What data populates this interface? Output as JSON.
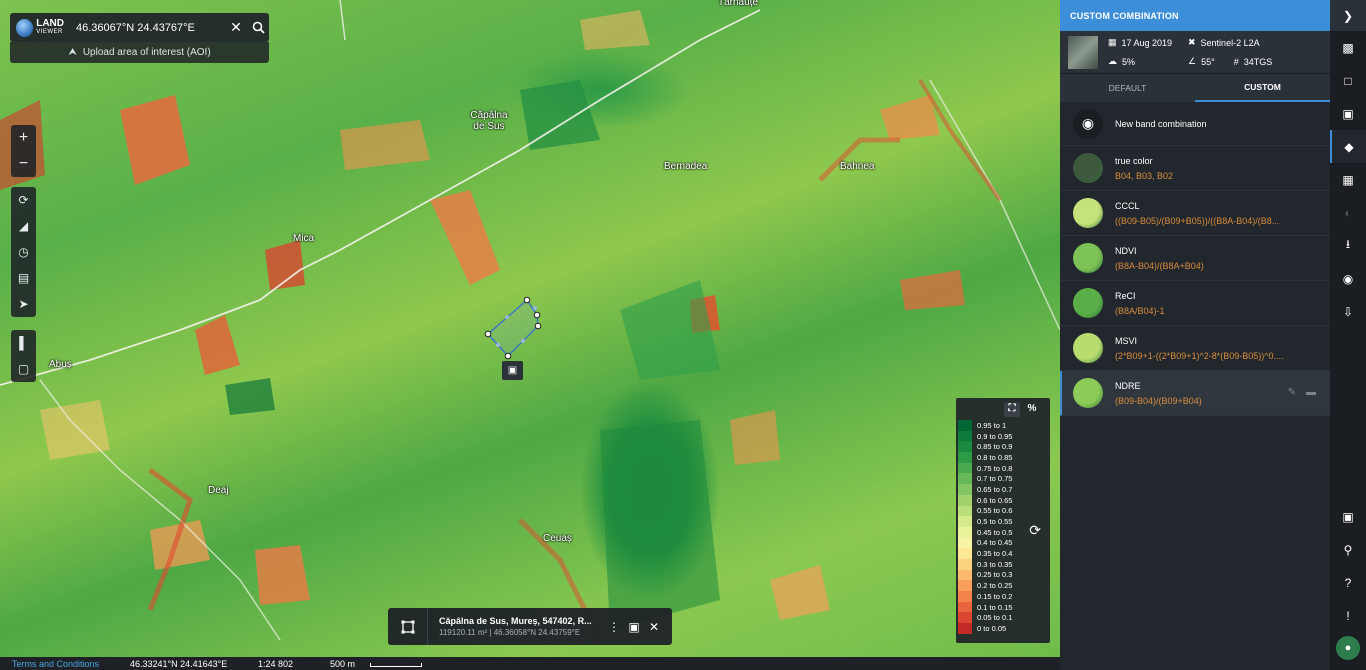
{
  "search": {
    "value": "46.36067°N 24.43767°E",
    "upload_label": "Upload area of interest (AOI)"
  },
  "logo": {
    "line1": "LAND",
    "line2": "VIEWER"
  },
  "places": [
    {
      "name": "Tărnăuțe"
    },
    {
      "name": "Căpâlna de Sus"
    },
    {
      "name": "Bernadea"
    },
    {
      "name": "Bahnea"
    },
    {
      "name": "Mica"
    },
    {
      "name": "Abuș"
    },
    {
      "name": "Deaj"
    },
    {
      "name": "Ceuaș"
    }
  ],
  "aoi": {
    "title": "Căpâlna de Sus, Mureș, 547402, R...",
    "info": "119120.11 m² | 46.36058°N 24.43759°E"
  },
  "legend": {
    "items": [
      {
        "label": "0.95 to 1",
        "color": "#006837"
      },
      {
        "label": "0.9 to 0.95",
        "color": "#0e7b3a"
      },
      {
        "label": "0.85 to 0.9",
        "color": "#1a8a3f"
      },
      {
        "label": "0.8 to 0.85",
        "color": "#2c9a46"
      },
      {
        "label": "0.75 to 0.8",
        "color": "#48a94e"
      },
      {
        "label": "0.7 to 0.75",
        "color": "#66b858"
      },
      {
        "label": "0.65 to 0.7",
        "color": "#84c563"
      },
      {
        "label": "0.6 to 0.65",
        "color": "#a1d26d"
      },
      {
        "label": "0.55 to 0.6",
        "color": "#bbdf7a"
      },
      {
        "label": "0.5 to 0.55",
        "color": "#d4ea8b"
      },
      {
        "label": "0.45 to 0.5",
        "color": "#e8f39c"
      },
      {
        "label": "0.4 to 0.45",
        "color": "#f7f4a6"
      },
      {
        "label": "0.35 to 0.4",
        "color": "#fde895"
      },
      {
        "label": "0.3 to 0.35",
        "color": "#fdd37f"
      },
      {
        "label": "0.25 to 0.3",
        "color": "#fcba6b"
      },
      {
        "label": "0.2 to 0.25",
        "color": "#f99f5b"
      },
      {
        "label": "0.15 to 0.2",
        "color": "#f3824b"
      },
      {
        "label": "0.1 to 0.15",
        "color": "#e8643d"
      },
      {
        "label": "0.05 to 0.1",
        "color": "#da4631"
      },
      {
        "label": "0 to 0.05",
        "color": "#c22a27"
      }
    ],
    "percent_label": "%"
  },
  "status": {
    "terms": "Terms and Conditions",
    "coords": "46.33241°N 24.41643°E",
    "scale": "1:24 802",
    "meter": "500 m"
  },
  "panel": {
    "title": "CUSTOM COMBINATION",
    "scene": {
      "date": "17 Aug 2019",
      "satellite": "Sentinel-2 L2A",
      "cloud": "5%",
      "angle": "55°",
      "tile": "34TGS"
    },
    "tabs": [
      {
        "label": "DEFAULT"
      },
      {
        "label": "CUSTOM"
      }
    ],
    "new_label": "New band combination",
    "bands": [
      {
        "name": "true color",
        "formula": "B04, B03, B02",
        "thumb": "#3d5a3f"
      },
      {
        "name": "CCCL",
        "formula": "((B09-B05)/(B09+B05))/((B8A-B04)/(B8...",
        "thumb": "#c6e27a"
      },
      {
        "name": "NDVI",
        "formula": "(B8A-B04)/(B8A+B04)",
        "thumb": "#7cc257"
      },
      {
        "name": "ReCI",
        "formula": "(B8A/B04)-1",
        "thumb": "#5aae48"
      },
      {
        "name": "MSVI",
        "formula": "(2*B09+1-((2*B09+1)^2-8*(B09-B05))^0....",
        "thumb": "#b8dc6e"
      },
      {
        "name": "NDRE",
        "formula": "(B09-B04)/(B09+B04)",
        "thumb": "#8ccb58"
      }
    ]
  }
}
